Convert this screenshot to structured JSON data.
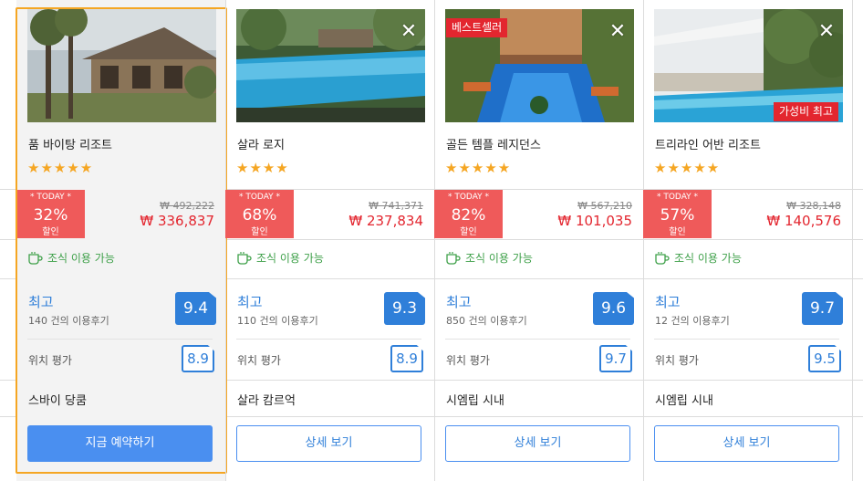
{
  "colors": {
    "accent_blue": "#2f7fd9",
    "today_red": "#ef5a5a",
    "price_red": "#e3262f",
    "breakfast_green": "#3ea049",
    "selected_border": "#f5a623",
    "star": "#f5a623"
  },
  "hotels": [
    {
      "name": "품 바이탕 리조트",
      "stars": "★★★★★",
      "today_label": "* TODAY *",
      "discount": "32%",
      "discount_suffix": "할인",
      "original_price": "₩ 492,222",
      "price": "₩ 336,837",
      "breakfast": "조식 이용 가능",
      "rating_word": "최고",
      "review_count": "140 건의 이용후기",
      "score": "9.4",
      "location_label": "위치 평가",
      "location_score": "8.9",
      "area": "스바이 당쿰",
      "button": "지금 예약하기",
      "selected": true,
      "tag": ""
    },
    {
      "name": "살라 로지",
      "stars": "★★★★",
      "today_label": "* TODAY *",
      "discount": "68%",
      "discount_suffix": "할인",
      "original_price": "₩ 741,371",
      "price": "₩ 237,834",
      "breakfast": "조식 이용 가능",
      "rating_word": "최고",
      "review_count": "110 건의 이용후기",
      "score": "9.3",
      "location_label": "위치 평가",
      "location_score": "8.9",
      "area": "살라 캄르억",
      "button": "상세 보기",
      "selected": false,
      "tag": ""
    },
    {
      "name": "골든 템플 레지던스",
      "stars": "★★★★★",
      "today_label": "* TODAY *",
      "discount": "82%",
      "discount_suffix": "할인",
      "original_price": "₩ 567,210",
      "price": "₩ 101,035",
      "breakfast": "조식 이용 가능",
      "rating_word": "최고",
      "review_count": "850 건의 이용후기",
      "score": "9.6",
      "location_label": "위치 평가",
      "location_score": "9.7",
      "area": "시엠립 시내",
      "button": "상세 보기",
      "selected": false,
      "tag": "베스트셀러"
    },
    {
      "name": "트리라인 어반 리조트",
      "stars": "★★★★★",
      "today_label": "* TODAY *",
      "discount": "57%",
      "discount_suffix": "할인",
      "original_price": "₩ 328,148",
      "price": "₩ 140,576",
      "breakfast": "조식 이용 가능",
      "rating_word": "최고",
      "review_count": "12 건의 이용후기",
      "score": "9.7",
      "location_label": "위치 평가",
      "location_score": "9.5",
      "area": "시엠립 시내",
      "button": "상세 보기",
      "selected": false,
      "tag": "가성비 최고"
    }
  ],
  "icons": {
    "close": "close-icon",
    "coffee": "coffee-cup-icon"
  }
}
